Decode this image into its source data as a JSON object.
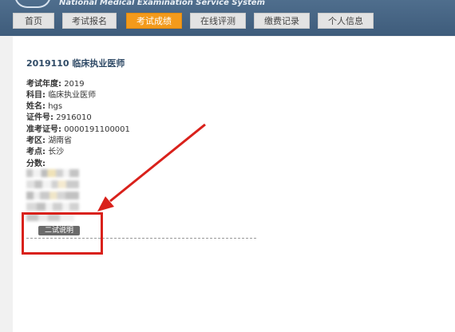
{
  "header": {
    "subtitle": "National Medical Examination Service System"
  },
  "nav": {
    "items": [
      {
        "label": "首页"
      },
      {
        "label": "考试报名"
      },
      {
        "label": "考试成绩",
        "active": true
      },
      {
        "label": "在线评测"
      },
      {
        "label": "缴费记录"
      },
      {
        "label": "个人信息"
      }
    ]
  },
  "exam": {
    "title": "2019110  临床执业医师",
    "fields": [
      {
        "label": "考试年度:",
        "value": "2019"
      },
      {
        "label": "科目:",
        "value": "临床执业医师"
      },
      {
        "label": "姓名:",
        "value": "hgs"
      },
      {
        "label": "证件号:",
        "value": "2916010"
      },
      {
        "label": "准考证号:",
        "value": "0000191100001"
      },
      {
        "label": "考区:",
        "value": "湖南省"
      },
      {
        "label": "考点:",
        "value": "长沙"
      },
      {
        "label": "分数:",
        "value": ""
      }
    ],
    "button_label": "二试说明"
  },
  "colors": {
    "header": "#4a6988",
    "active_tab": "#f39a1b",
    "annotation": "#d9211b"
  }
}
